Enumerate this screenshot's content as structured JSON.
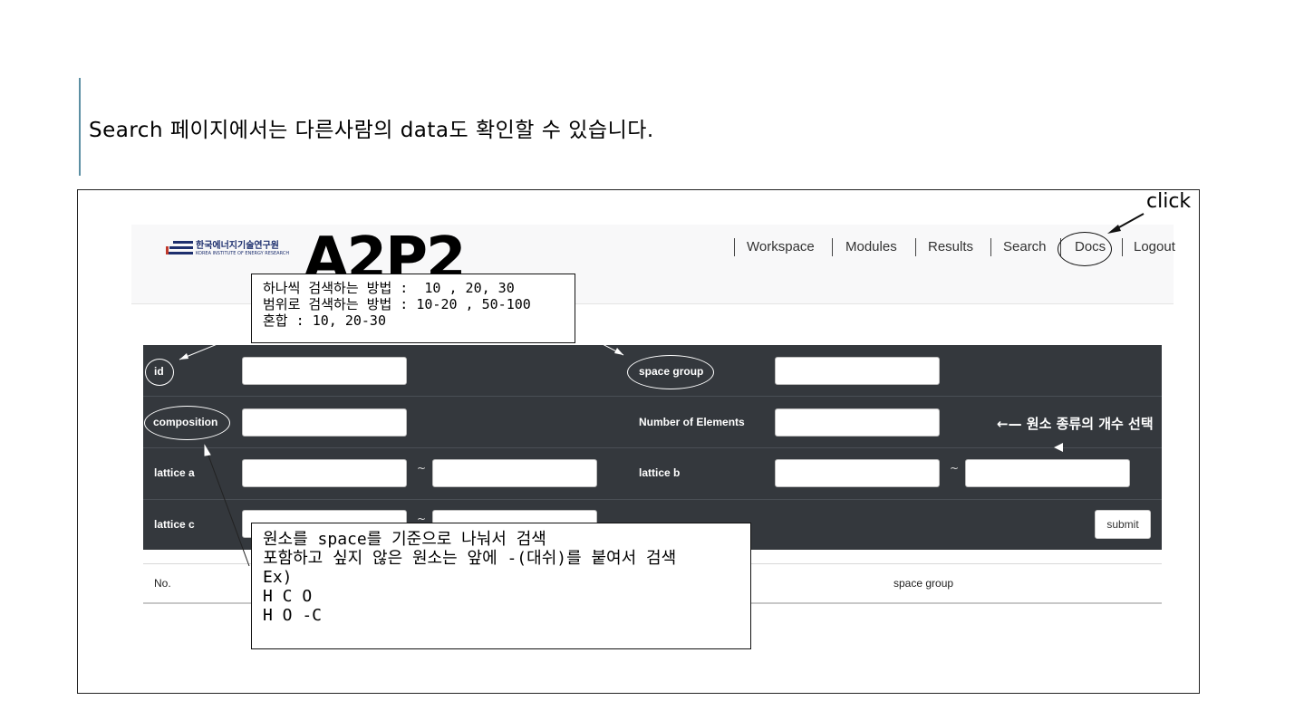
{
  "headline": {
    "text": "Search 페이지에서는 다른사람의 data도 확인할 수 있습니다."
  },
  "site": {
    "logo_kor": "한국에너지기술연구원",
    "logo_eng": "KOREA INSTITUTE OF ENERGY RESEARCH",
    "brand": "A2P2",
    "nav": [
      "Workspace",
      "Modules",
      "Results",
      "Search",
      "Docs",
      "Logout"
    ]
  },
  "search_form": {
    "id_label": "id",
    "space_group_label": "space group",
    "composition_label": "composition",
    "num_elements_label": "Number of Elements",
    "lattice_a_label": "lattice a",
    "lattice_b_label": "lattice b",
    "lattice_c_label": "lattice c",
    "range_sep": "~",
    "submit_label": "submit"
  },
  "results_table": {
    "columns": [
      "No.",
      "space group"
    ]
  },
  "annotations": {
    "click_label": "click",
    "id_note": [
      "하나씩 검색하는 방법 :  10 , 20, 30",
      "범위로 검색하는 방법 : 10-20 , 50-100",
      "혼합 : 10, 20-30"
    ],
    "composition_note": [
      "원소를 space를 기준으로 나눠서 검색",
      "포함하고 싶지 않은 원소는 앞에 -(대쉬)를 붙여서 검색",
      "Ex)",
      "H C O",
      "H O -C"
    ],
    "elements_note": "←— 원소 종류의 개수 선택"
  }
}
